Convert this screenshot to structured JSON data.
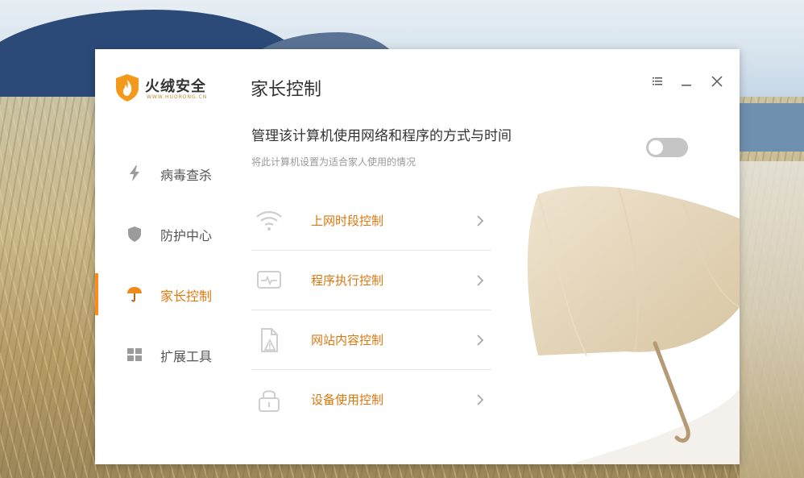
{
  "app": {
    "logo_name": "火绒安全",
    "logo_url": "WWW.HUORONG.CN"
  },
  "sidebar": {
    "items": [
      {
        "label": "病毒查杀",
        "icon": "lightning-icon",
        "active": false
      },
      {
        "label": "防护中心",
        "icon": "shield-icon",
        "active": false
      },
      {
        "label": "家长控制",
        "icon": "umbrella-icon",
        "active": true
      },
      {
        "label": "扩展工具",
        "icon": "grid-icon",
        "active": false
      }
    ]
  },
  "main": {
    "title": "家长控制",
    "headline": "管理该计算机使用网络和程序的方式与时间",
    "subline": "将此计算机设置为适合家人使用的情况",
    "toggle_on": false,
    "rows": [
      {
        "label": "上网时段控制",
        "icon": "wifi-icon"
      },
      {
        "label": "程序执行控制",
        "icon": "monitor-pulse-icon"
      },
      {
        "label": "网站内容控制",
        "icon": "document-warning-icon"
      },
      {
        "label": "设备使用控制",
        "icon": "lock-icon"
      }
    ]
  },
  "window_controls": [
    "menu-icon",
    "minimize-icon",
    "close-icon"
  ],
  "colors": {
    "accent": "#e07b12",
    "indicator": "#ff8a1a",
    "toggle_off": "#c5c5c5"
  }
}
